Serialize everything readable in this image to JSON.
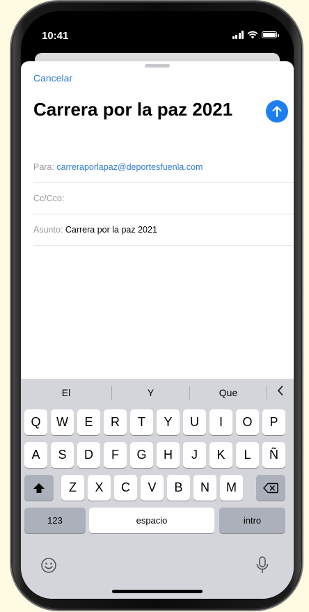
{
  "status_bar": {
    "time": "10:41",
    "icons": [
      "signal-icon",
      "wifi-icon",
      "battery-icon"
    ]
  },
  "compose": {
    "cancel_label": "Cancelar",
    "title": "Carrera por la paz 2021",
    "send_icon": "arrow-up-icon",
    "to": {
      "label": "Para:",
      "value": "carreraporlapaz@deportesfuenla.com"
    },
    "cc": {
      "label": "Cc/Cco:",
      "value": ""
    },
    "subject": {
      "label": "Asunto:",
      "value": "Carrera por la paz 2021"
    }
  },
  "keyboard": {
    "suggestions": [
      "El",
      "Y",
      "Que"
    ],
    "collapse_icon": "chevron-left-icon",
    "row1": [
      "Q",
      "W",
      "E",
      "R",
      "T",
      "Y",
      "U",
      "I",
      "O",
      "P"
    ],
    "row2": [
      "A",
      "S",
      "D",
      "F",
      "G",
      "H",
      "J",
      "K",
      "L",
      "Ñ"
    ],
    "row3": [
      "Z",
      "X",
      "C",
      "V",
      "B",
      "N",
      "M"
    ],
    "shift_icon": "shift-icon",
    "delete_icon": "delete-icon",
    "numbers_label": "123",
    "space_label": "espacio",
    "return_label": "intro",
    "emoji_icon": "emoji-icon",
    "mic_icon": "microphone-icon"
  },
  "colors": {
    "accent": "#1c7ef0",
    "link": "#2f7bd6",
    "keyboard_bg": "#d3d5db"
  }
}
